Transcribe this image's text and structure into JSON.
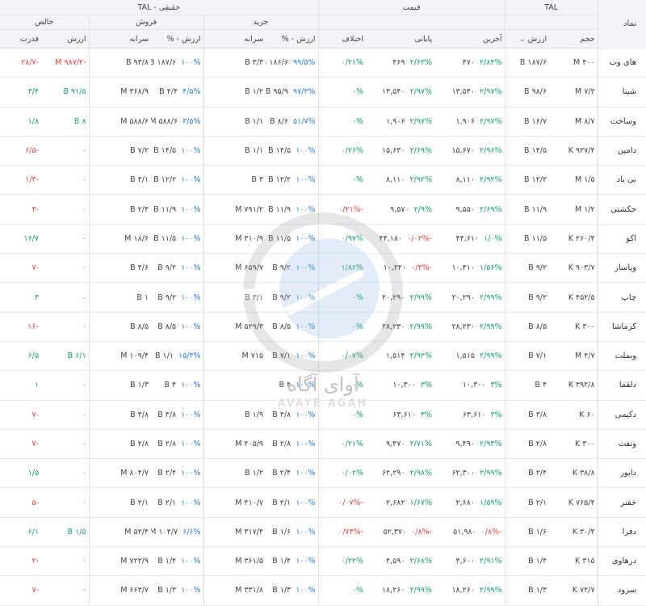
{
  "header": {
    "symbol_label": "نماد",
    "tal_label": "TAL",
    "price_label": "قیمت",
    "haqiqi_label": "حقیقی - TAL",
    "buy_label": "خرید",
    "sell_label": "فروش",
    "net_label": "خالص",
    "cols": {
      "volume": "حجم",
      "value": "ارزش",
      "sort_icon": "chevron-down-icon",
      "last": "آخرین",
      "final": "پایانی",
      "diff": "اختلاف",
      "buy_value_pct": "ارزش - %",
      "buy_per_capita": "سرانه",
      "sell_value_pct": "ارزش - %",
      "sell_per_capita": "سرانه",
      "net_value": "ارزش",
      "net_power": "قدرت"
    }
  },
  "watermark": {
    "text": "آوای آگاه",
    "sub": "AVAYE AGAH"
  },
  "colors": {
    "positive": "#1a9e72",
    "negative": "#e0443e",
    "pct_blue": "#2b7fd8"
  },
  "rows": [
    {
      "symbol": "های وب",
      "volume": "۴۰۰ M",
      "value": "۱۸۷/۶ B",
      "last_val": "۴۷۰",
      "last_pct": "۲/۸۴%",
      "last_c": "g",
      "final_val": "۴۶۹",
      "final_pct": "۲/۶۳%",
      "final_c": "g",
      "diff": "۰/۲۱%",
      "diff_c": "g",
      "buy_pc": "۳/۳ B",
      "buy_val": "۱۸۶/۶ B",
      "buy_pct": "۹۹/۵%",
      "sell_pc": "",
      "sell_val": "۱۸۷/۶ B",
      "sell_pct": "۱۰۰%",
      "net_pc": "۹۳/۸ B",
      "net_val": "-۹۸۷/۲ M",
      "net_c": "r",
      "power": "-۲۸/۷",
      "power_c": "r"
    },
    {
      "symbol": "شینا",
      "volume": "۷/۳ M",
      "value": "۹۸/۶ B",
      "last_val": "۱۳,۵۴۰",
      "last_pct": "۲/۹۷%",
      "last_c": "g",
      "final_val": "۱۳,۵۴۰",
      "final_pct": "۲/۹۷%",
      "final_c": "g",
      "diff": "۰%",
      "diff_c": "g",
      "buy_pc": "۱/۲ B",
      "buy_val": "۹۵/۹ B",
      "buy_pct": "۹۷/۳%",
      "sell_pc": "",
      "sell_val": "۴/۴ B",
      "sell_pct": "۴/۵%",
      "net_pc": "۳۶۸/۹ M",
      "net_val": "۹۱/۵ B",
      "net_c": "g",
      "power": "۳/۴",
      "power_c": "g"
    },
    {
      "symbol": "وساخت",
      "volume": "۸/۷ M",
      "value": "۱۶/۷ B",
      "last_val": "۱,۹۰۶",
      "last_pct": "۲/۹۷%",
      "last_c": "g",
      "final_val": "۱,۹۰۶",
      "final_pct": "۲/۹۷%",
      "final_c": "g",
      "diff": "۰%",
      "diff_c": "g",
      "buy_pc": "۱/۱ B",
      "buy_val": "۸/۶ B",
      "buy_pct": "۵۱/۷%",
      "sell_pc": "",
      "sell_val": "۵۸۸/۶ M",
      "sell_pct": "۳/۵%",
      "net_pc": "۵۸۸/۶ M",
      "net_val": "۸ B",
      "net_c": "g",
      "power": "۱/۸",
      "power_c": "g"
    },
    {
      "symbol": "دامین",
      "volume": "۹۲۷/۴ K",
      "value": "۱۴/۵ B",
      "last_val": "۱۵,۶۷۰",
      "last_pct": "۲/۹۶%",
      "last_c": "g",
      "final_val": "۱۵,۶۳۰",
      "final_pct": "۲/۶۹%",
      "final_c": "g",
      "diff": "۰/۲۶%",
      "diff_c": "g",
      "buy_pc": "۱/۱ B",
      "buy_val": "۱۴/۵ B",
      "buy_pct": "۱۰۰%",
      "sell_pc": "",
      "sell_val": "۱۴/۵ B",
      "sell_pct": "۱۰۰%",
      "net_pc": "۷/۲ B",
      "net_val": "۰",
      "net_c": "g",
      "power": "-۶/۵",
      "power_c": "r"
    },
    {
      "symbol": "بی باد",
      "volume": "۱/۵ M",
      "value": "۱۲/۲ B",
      "last_val": "۸,۱۱۰",
      "last_pct": "۲/۹۲%",
      "last_c": "g",
      "final_val": "۸,۱۱۰",
      "final_pct": "۲/۹۲%",
      "final_c": "g",
      "diff": "۰%",
      "diff_c": "g",
      "buy_pc": "۳ B",
      "buy_val": "۱۲/۲ B",
      "buy_pct": "۱۰۰%",
      "sell_pc": "",
      "sell_val": "۱۲/۲ B",
      "sell_pct": "۱۰۰%",
      "net_pc": "۴/۱ B",
      "net_val": "۰",
      "net_c": "g",
      "power": "-۱/۳",
      "power_c": "r"
    },
    {
      "symbol": "حکشتی",
      "volume": "۱/۲ M",
      "value": "۱۱/۹ B",
      "last_val": "۹,۵۵۰",
      "last_pct": "۲/۶۹%",
      "last_c": "g",
      "final_val": "۹,۵۷۰",
      "final_pct": "۲/۹%",
      "final_c": "g",
      "diff": "-۰/۲۱%",
      "diff_c": "r",
      "buy_pc": "۷۹۱/۲ M",
      "buy_val": "۱۱/۹ B",
      "buy_pct": "۱۰۰%",
      "sell_pc": "",
      "sell_val": "۱۱/۹ B",
      "sell_pct": "۱۰۰%",
      "net_pc": "۲/۴ B",
      "net_val": "۰",
      "net_c": "g",
      "power": "-۳",
      "power_c": "r"
    },
    {
      "symbol": "اکو",
      "volume": "۲۶۰/۴ K",
      "value": "۱۱/۵ B",
      "last_val": "۴۴,۶۱۰",
      "last_pct": "۱/۰%",
      "last_c": "g",
      "final_val": "۴۴,۱۸۰",
      "final_pct": "-۰/۰۲%",
      "final_c": "r",
      "diff": "۰/۹۷%",
      "diff_c": "g",
      "buy_pc": "۳۱۰/۹ M",
      "buy_val": "۱۱/۵ B",
      "buy_pct": "۱۰۰%",
      "sell_pc": "",
      "sell_val": "۱۱/۵ B",
      "sell_pct": "۱۰۰%",
      "net_pc": "۱۸/۶ M",
      "net_val": "۰",
      "net_c": "g",
      "power": "۱۶/۷",
      "power_c": "g"
    },
    {
      "symbol": "وپاسار",
      "volume": "۹۰۳/۷ K",
      "value": "۹/۲ B",
      "last_val": "۱۰,۴۱۰",
      "last_pct": "۱/۵۶%",
      "last_c": "g",
      "final_val": "۱۰,۲۲۰",
      "final_pct": "-۰/۳%",
      "final_c": "r",
      "diff": "۱/۸۶%",
      "diff_c": "g",
      "buy_pc": "۶۵۹/۷ M",
      "buy_val": "۹/۲ B",
      "buy_pct": "۱۰۰%",
      "sell_pc": "",
      "sell_val": "۹/۲ B",
      "sell_pct": "۱۰۰%",
      "net_pc": "۴/۶ B",
      "net_val": "۰",
      "net_c": "g",
      "power": "-۷",
      "power_c": "r"
    },
    {
      "symbol": "چاپ",
      "volume": "۴۵۲/۵ K",
      "value": "۹/۲ B",
      "last_val": "۲۰,۲۹۰",
      "last_pct": "۲/۹۹%",
      "last_c": "g",
      "final_val": "۲۰,۲۹۰",
      "final_pct": "۲/۹۹%",
      "final_c": "g",
      "diff": "۰%",
      "diff_c": "g",
      "buy_pc": "۳/۱ B",
      "buy_val": "۹/۲ B",
      "buy_pct": "۱۰۰%",
      "sell_pc": "",
      "sell_val": "۹/۲ B",
      "sell_pct": "۱۰۰%",
      "net_pc": "۱ B",
      "net_val": "۰",
      "net_c": "g",
      "power": "۳",
      "power_c": "g"
    },
    {
      "symbol": "کرماشا",
      "volume": "۳۰۰ K",
      "value": "۸/۵ B",
      "last_val": "۲۸,۲۳۰",
      "last_pct": "۲/۹۹%",
      "last_c": "g",
      "final_val": "۲۸,۲۳۰",
      "final_pct": "۲/۹۹%",
      "final_c": "g",
      "diff": "۰%",
      "diff_c": "g",
      "buy_pc": "۵۲۹/۳ M",
      "buy_val": "۸/۵ B",
      "buy_pct": "۱۰۰%",
      "sell_pc": "",
      "sell_val": "۸/۵ B",
      "sell_pct": "۱۰۰%",
      "net_pc": "۸/۵ B",
      "net_val": "۰",
      "net_c": "g",
      "power": "-۱۶",
      "power_c": "r"
    },
    {
      "symbol": "وبملت",
      "volume": "۴/۷ M",
      "value": "۷/۱ B",
      "last_val": "۱,۵۱۵",
      "last_pct": "۲/۹۹%",
      "last_c": "g",
      "final_val": "۱,۵۱۴",
      "final_pct": "۲/۹۲%",
      "final_c": "g",
      "diff": "۰/۰۷%",
      "diff_c": "g",
      "buy_pc": "۷۱۵ M",
      "buy_val": "۷/۱ B",
      "buy_pct": "۱۰۰%",
      "sell_pc": "",
      "sell_val": "۱/۱ B",
      "sell_pct": "۱۵/۳%",
      "net_pc": "۱۰۹/۴ M",
      "net_val": "۶/۱ B",
      "net_c": "g",
      "power": "۶/۵",
      "power_c": "g"
    },
    {
      "symbol": "دلقما",
      "volume": "۳۹۲/۸ K",
      "value": "۴ B",
      "last_val": "۱۰,۳۰۰",
      "last_pct": "۳%",
      "last_c": "g",
      "final_val": "۱۰,۳۰۰",
      "final_pct": "۳%",
      "final_c": "g",
      "diff": "۰%",
      "diff_c": "g",
      "buy_pc": "",
      "buy_val": "۴ B",
      "buy_pct": "۱۰۰%",
      "sell_pc": "",
      "sell_val": "۴ B",
      "sell_pct": "۱۰۰%",
      "net_pc": "۱/۳ B",
      "net_val": "۰",
      "net_c": "g",
      "power": "۱",
      "power_c": "g"
    },
    {
      "symbol": "دکیمی",
      "volume": "۶۰ K",
      "value": "۳/۸ B",
      "last_val": "۶۳,۶۱۰",
      "last_pct": "۳%",
      "last_c": "g",
      "final_val": "۶۳,۶۱۰",
      "final_pct": "۳%",
      "final_c": "g",
      "diff": "۰%",
      "diff_c": "g",
      "buy_pc": "۱/۹ B",
      "buy_val": "۳/۸ B",
      "buy_pct": "۱۰۰%",
      "sell_pc": "",
      "sell_val": "۳/۸ B",
      "sell_pct": "۱۰۰%",
      "net_pc": "۳/۸ B",
      "net_val": "۰",
      "net_c": "g",
      "power": "-۷",
      "power_c": "r"
    },
    {
      "symbol": "ونفت",
      "volume": "۳۰۰ K",
      "value": "۲/۸ B",
      "last_val": "۹,۴۹۰",
      "last_pct": "۲/۹۳%",
      "last_c": "g",
      "final_val": "۹,۴۷۰",
      "final_pct": "۲/۷۱%",
      "final_c": "g",
      "diff": "۰/۲۱%",
      "diff_c": "g",
      "buy_pc": "۴۰۵/۹ M",
      "buy_val": "۲/۸ B",
      "buy_pct": "۱۰۰%",
      "sell_pc": "",
      "sell_val": "۲/۸ B",
      "sell_pct": "۱۰۰%",
      "net_pc": "۲/۸ B",
      "net_val": "۰",
      "net_c": "g",
      "power": "-۷",
      "power_c": "r"
    },
    {
      "symbol": "دابور",
      "volume": "۳۸/۸ K",
      "value": "۲/۴ B",
      "last_val": "۶۲,۳۰۰",
      "last_pct": "۲/۹۹%",
      "last_c": "g",
      "final_val": "۶۲,۲۹۰",
      "final_pct": "۲/۹۸%",
      "final_c": "g",
      "diff": "۰/۰۲%",
      "diff_c": "g",
      "buy_pc": "۱/۲ B",
      "buy_val": "۲/۴ B",
      "buy_pct": "۱۰۰%",
      "sell_pc": "",
      "sell_val": "۲/۴ B",
      "sell_pct": "۱۰۰%",
      "net_pc": "۸۰۴/۷ M",
      "net_val": "۰",
      "net_c": "g",
      "power": "۱/۵",
      "power_c": "g"
    },
    {
      "symbol": "خفنر",
      "volume": "۷۶۵/۴ K",
      "value": "۲/۱ B",
      "last_val": "۲,۶۸۰",
      "last_pct": "۱/۵۹%",
      "last_c": "g",
      "final_val": "۲,۶۸۲",
      "final_pct": "۱/۶۷%",
      "final_c": "g",
      "diff": "-۰/۰۷%",
      "diff_c": "r",
      "buy_pc": "۴۱۰/۷ M",
      "buy_val": "۲/۱ B",
      "buy_pct": "۱۰۰%",
      "sell_pc": "",
      "sell_val": "۲/۱ B",
      "sell_pct": "۱۰۰%",
      "net_pc": "۲/۱ B",
      "net_val": "۰",
      "net_c": "g",
      "power": "-۵",
      "power_c": "r"
    },
    {
      "symbol": "دفرا",
      "volume": "۳۰/۳ K",
      "value": "۱/۶ B",
      "last_val": "۵۱,۹۸۰",
      "last_pct": "-۰/۸%",
      "last_c": "r",
      "final_val": "۵۲,۳۷۰",
      "final_pct": "-۰/۸%",
      "final_c": "r",
      "diff": "-۰/۷۴%",
      "diff_c": "r",
      "buy_pc": "۳۱۷/۴ M",
      "buy_val": "۱/۶ B",
      "buy_pct": "۱۰۰%",
      "sell_pc": "",
      "sell_val": "۱۰۴/۷ M",
      "sell_pct": "۶/۶%",
      "net_pc": "۵۲/۴ M",
      "net_val": "۱/۵ B",
      "net_c": "g",
      "power": "۶/۱",
      "power_c": "g"
    },
    {
      "symbol": "درهاوی",
      "volume": "۳۱۵ K",
      "value": "۱/۴ B",
      "last_val": "۴,۶۰۰",
      "last_pct": "۲/۹۱%",
      "last_c": "g",
      "final_val": "۴,۵۹۰",
      "final_pct": "۲/۶۸%",
      "final_c": "g",
      "diff": "۰/۲۲%",
      "diff_c": "g",
      "buy_pc": "۳۶۱/۵ M",
      "buy_val": "۱/۴ B",
      "buy_pct": "۱۰۰%",
      "sell_pc": "",
      "sell_val": "۱/۴ B",
      "sell_pct": "۱۰۰%",
      "net_pc": "۷۲۲/۹ M",
      "net_val": "۰",
      "net_c": "g",
      "power": "-۲",
      "power_c": "r"
    },
    {
      "symbol": "سرود",
      "volume": "۷۲/۷ K",
      "value": "۱/۳ B",
      "last_val": "۱۸,۲۶۰",
      "last_pct": "۲/۹۹%",
      "last_c": "g",
      "final_val": "۱۸,۲۶۰",
      "final_pct": "۲/۹۹%",
      "final_c": "g",
      "diff": "۰%",
      "diff_c": "g",
      "buy_pc": "۳۳۱/۸ M",
      "buy_val": "۱/۳ B",
      "buy_pct": "۱۰۰%",
      "sell_pc": "",
      "sell_val": "۱/۳ B",
      "sell_pct": "۱۰۰%",
      "net_pc": "۶۶۳/۷ M",
      "net_val": "۰",
      "net_c": "g",
      "power": "-۷",
      "power_c": "r"
    }
  ]
}
